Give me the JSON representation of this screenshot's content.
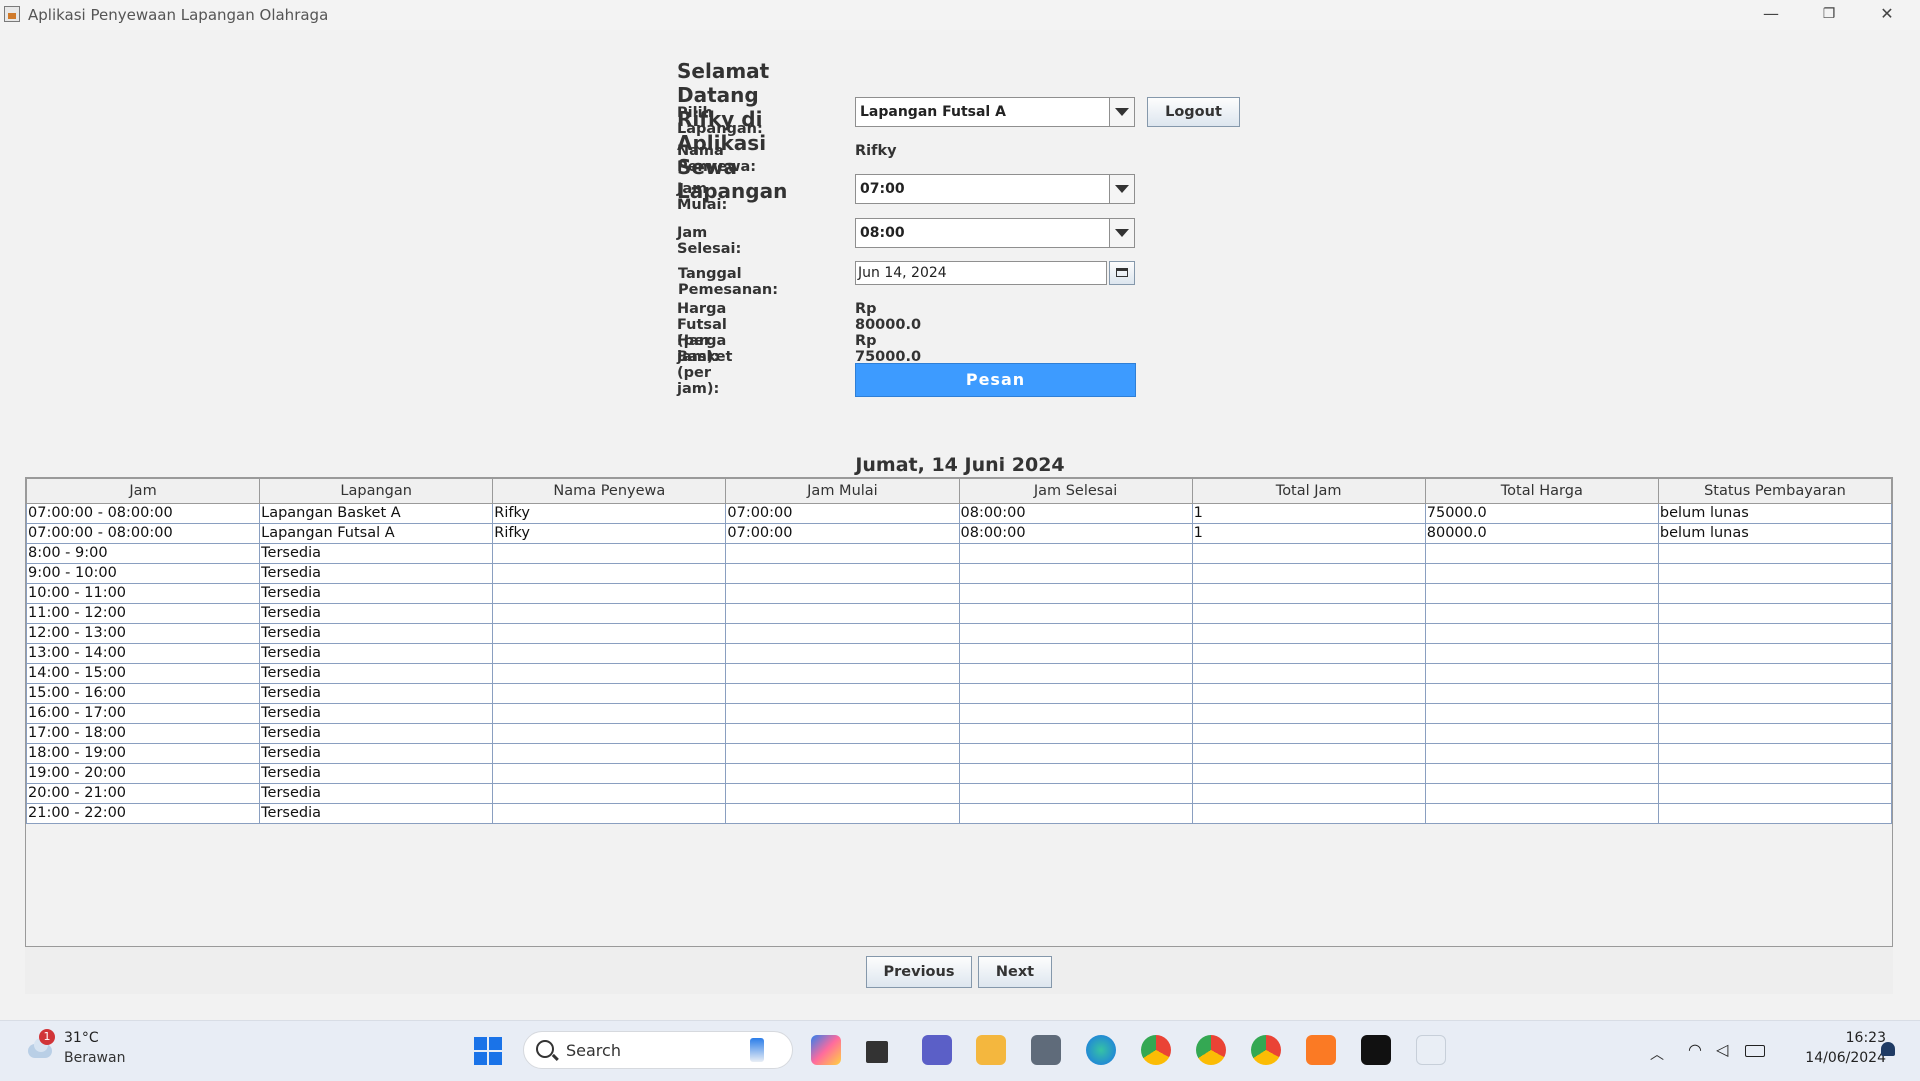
{
  "window": {
    "title": "Aplikasi Penyewaan Lapangan Olahraga",
    "minimize_glyph": "—",
    "restore_glyph": "❐",
    "close_glyph": "✕"
  },
  "form": {
    "heading": "Selamat Datang Rifky di Aplikasi Sewa Lapangan",
    "field_label": "Pilih Lapangan:",
    "field_value": "Lapangan Futsal A",
    "logout_label": "Logout",
    "renter_label": "Nama Penyewa:",
    "renter_value": "Rifky",
    "start_label": "Jam Mulai:",
    "start_value": "07:00",
    "end_label": "Jam Selesai:",
    "end_value": "08:00",
    "date_label": "Tanggal Pemesanan:",
    "date_value": "Jun 14, 2024",
    "futsal_price_label": "Harga Futsal (per jam):",
    "futsal_price_value": "Rp 80000.0",
    "basket_price_label": "Harga Basket (per jam):",
    "basket_price_value": "Rp 75000.0",
    "submit_label": "Pesan"
  },
  "schedule": {
    "date_heading": "Jumat, 14 Juni 2024",
    "columns": [
      "Jam",
      "Lapangan",
      "Nama Penyewa",
      "Jam Mulai",
      "Jam Selesai",
      "Total Jam",
      "Total Harga",
      "Status Pembayaran"
    ],
    "rows": [
      [
        "07:00:00 - 08:00:00",
        "Lapangan Basket A",
        "Rifky",
        "07:00:00",
        "08:00:00",
        "1",
        "75000.0",
        "belum lunas"
      ],
      [
        "07:00:00 - 08:00:00",
        "Lapangan Futsal A",
        "Rifky",
        "07:00:00",
        "08:00:00",
        "1",
        "80000.0",
        "belum lunas"
      ],
      [
        "8:00 - 9:00",
        "Tersedia",
        "",
        "",
        "",
        "",
        "",
        ""
      ],
      [
        "9:00 - 10:00",
        "Tersedia",
        "",
        "",
        "",
        "",
        "",
        ""
      ],
      [
        "10:00 - 11:00",
        "Tersedia",
        "",
        "",
        "",
        "",
        "",
        ""
      ],
      [
        "11:00 - 12:00",
        "Tersedia",
        "",
        "",
        "",
        "",
        "",
        ""
      ],
      [
        "12:00 - 13:00",
        "Tersedia",
        "",
        "",
        "",
        "",
        "",
        ""
      ],
      [
        "13:00 - 14:00",
        "Tersedia",
        "",
        "",
        "",
        "",
        "",
        ""
      ],
      [
        "14:00 - 15:00",
        "Tersedia",
        "",
        "",
        "",
        "",
        "",
        ""
      ],
      [
        "15:00 - 16:00",
        "Tersedia",
        "",
        "",
        "",
        "",
        "",
        ""
      ],
      [
        "16:00 - 17:00",
        "Tersedia",
        "",
        "",
        "",
        "",
        "",
        ""
      ],
      [
        "17:00 - 18:00",
        "Tersedia",
        "",
        "",
        "",
        "",
        "",
        ""
      ],
      [
        "18:00 - 19:00",
        "Tersedia",
        "",
        "",
        "",
        "",
        "",
        ""
      ],
      [
        "19:00 - 20:00",
        "Tersedia",
        "",
        "",
        "",
        "",
        "",
        ""
      ],
      [
        "20:00 - 21:00",
        "Tersedia",
        "",
        "",
        "",
        "",
        "",
        ""
      ],
      [
        "21:00 - 22:00",
        "Tersedia",
        "",
        "",
        "",
        "",
        "",
        ""
      ]
    ],
    "previous_label": "Previous",
    "next_label": "Next"
  },
  "taskbar": {
    "weather_temp": "31°C",
    "weather_desc": "Berawan",
    "weather_badge": "1",
    "search_placeholder": "Search",
    "time": "16:23",
    "date": "14/06/2024",
    "apps": [
      "start-icon",
      "copilot-icon",
      "task-view-icon",
      "teams-icon",
      "file-explorer-icon",
      "camera-icon",
      "edge-icon",
      "chrome-icon",
      "chrome-profile-icon",
      "chrome-profile-m-icon",
      "xampp-icon",
      "intellij-icon",
      "java-icon"
    ]
  },
  "colors": {
    "accent": "#3d9bff",
    "grid_line": "#8a9fc0",
    "background": "#f2f2f2"
  }
}
